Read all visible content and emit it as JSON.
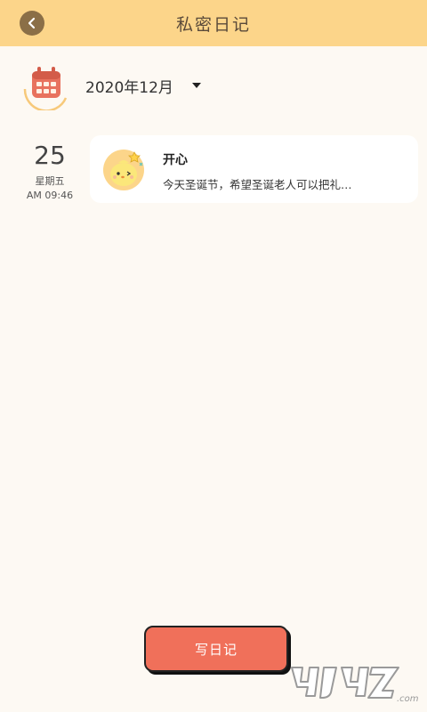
{
  "header": {
    "title": "私密日记",
    "back_icon": "chevron-left-icon"
  },
  "month_selector": {
    "calendar_icon": "calendar-icon",
    "label": "2020年12月",
    "caret_icon": "caret-down-icon"
  },
  "entries": [
    {
      "day": "25",
      "weekday": "星期五",
      "time": "AM 09:46",
      "avatar_icon": "chick-mood-icon",
      "mood": "开心",
      "preview": "今天圣诞节，希望圣诞老人可以把礼…"
    }
  ],
  "write_button": {
    "label": "写日记"
  },
  "watermark": {
    "text": "4u4u7.com"
  },
  "colors": {
    "header_bg": "#FCD58A",
    "page_bg": "#FDF9F3",
    "accent": "#F0705A",
    "back_button": "#8B6F47"
  }
}
